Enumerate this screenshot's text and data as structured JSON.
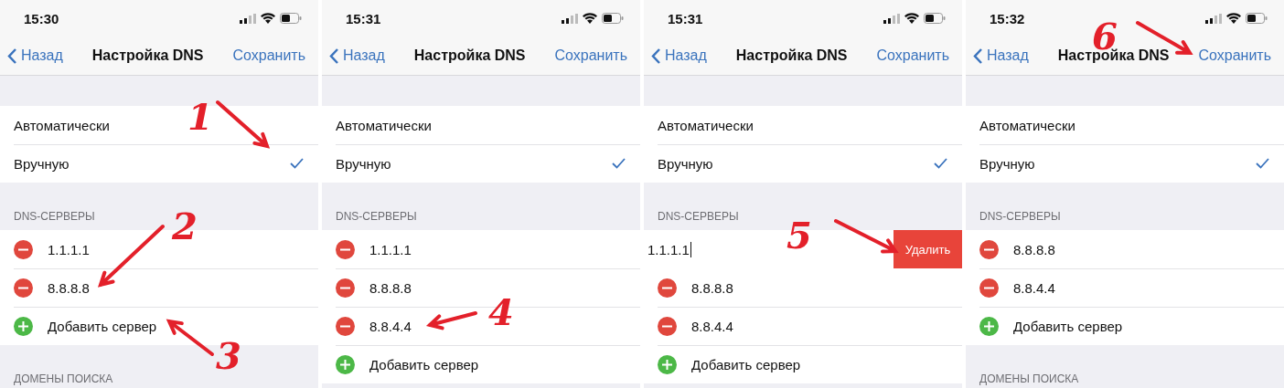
{
  "panels": [
    {
      "time": "15:30",
      "nav": {
        "back": "Назад",
        "title": "Настройка DNS",
        "save": "Сохранить"
      },
      "modes": [
        {
          "label": "Автоматически",
          "selected": false
        },
        {
          "label": "Вручную",
          "selected": true
        }
      ],
      "servers_header": "DNS-СЕРВЕРЫ",
      "servers": [
        {
          "kind": "server",
          "text": "1.1.1.1"
        },
        {
          "kind": "server",
          "text": "8.8.8.8"
        },
        {
          "kind": "add",
          "text": "Добавить сервер"
        }
      ],
      "domains_header": "ДОМЕНЫ ПОИСКА",
      "annotations": [
        "1",
        "2",
        "3"
      ]
    },
    {
      "time": "15:31",
      "nav": {
        "back": "Назад",
        "title": "Настройка DNS",
        "save": "Сохранить"
      },
      "modes": [
        {
          "label": "Автоматически",
          "selected": false
        },
        {
          "label": "Вручную",
          "selected": true
        }
      ],
      "servers_header": "DNS-СЕРВЕРЫ",
      "servers": [
        {
          "kind": "server",
          "text": "1.1.1.1"
        },
        {
          "kind": "server",
          "text": "8.8.8.8"
        },
        {
          "kind": "server",
          "text": "8.8.4.4"
        },
        {
          "kind": "add",
          "text": "Добавить сервер"
        }
      ],
      "annotations": [
        "4"
      ]
    },
    {
      "time": "15:31",
      "nav": {
        "back": "Назад",
        "title": "Настройка DNS",
        "save": "Сохранить"
      },
      "modes": [
        {
          "label": "Автоматически",
          "selected": false
        },
        {
          "label": "Вручную",
          "selected": true
        }
      ],
      "servers_header": "DNS-СЕРВЕРЫ",
      "servers": [
        {
          "kind": "swiped",
          "text": "1.1.1.1",
          "action": "Удалить"
        },
        {
          "kind": "server",
          "text": "8.8.8.8"
        },
        {
          "kind": "server",
          "text": "8.8.4.4"
        },
        {
          "kind": "add",
          "text": "Добавить сервер"
        }
      ],
      "annotations": [
        "5"
      ]
    },
    {
      "time": "15:32",
      "nav": {
        "back": "Назад",
        "title": "Настройка DNS",
        "save": "Сохранить"
      },
      "modes": [
        {
          "label": "Автоматически",
          "selected": false
        },
        {
          "label": "Вручную",
          "selected": true
        }
      ],
      "servers_header": "DNS-СЕРВЕРЫ",
      "servers": [
        {
          "kind": "server",
          "text": "8.8.8.8"
        },
        {
          "kind": "server",
          "text": "8.8.4.4"
        },
        {
          "kind": "add",
          "text": "Добавить сервер"
        }
      ],
      "domains_header": "ДОМЕНЫ ПОИСКА",
      "annotations": [
        "6"
      ]
    }
  ]
}
